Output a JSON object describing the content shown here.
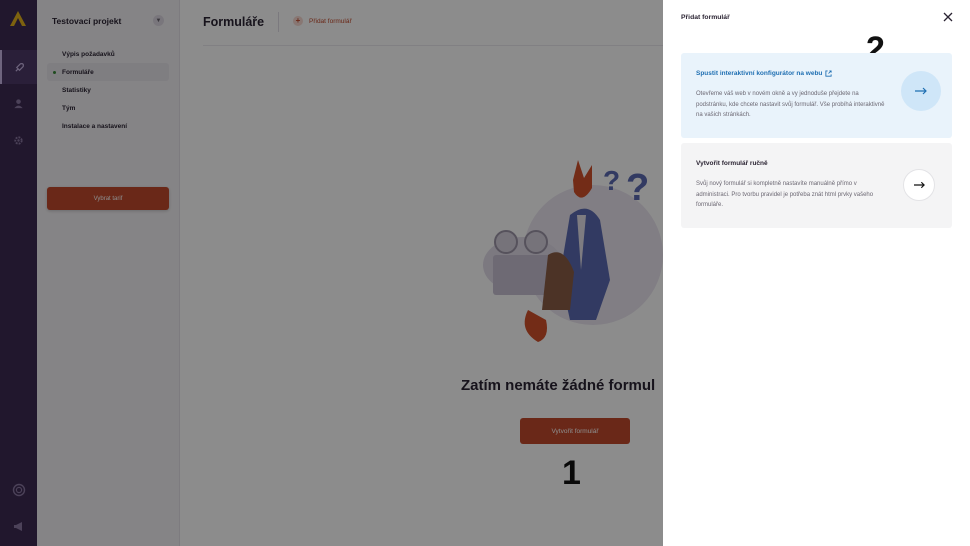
{
  "sidebar": {
    "project_name": "Testovací projekt",
    "items": [
      {
        "label": "Výpis požadavků"
      },
      {
        "label": "Formuláře"
      },
      {
        "label": "Statistiky"
      },
      {
        "label": "Tým"
      },
      {
        "label": "Instalace a nastavení"
      }
    ],
    "tariff_button": "Vybrat tarif"
  },
  "main": {
    "title": "Formuláře",
    "add_link": "Přidat formulář",
    "empty_text": "Zatím nemáte žádné formul",
    "create_button": "Vytvořit formulář"
  },
  "markers": {
    "one": "1",
    "two": "2"
  },
  "drawer": {
    "title": "Přidat formulář",
    "cards": [
      {
        "title": "Spustit interaktivní konfigurátor na webu",
        "description": "Otevřeme váš web v novém okně a vy jednoduše přejdete na podstránku, kde chcete nastavit svůj formulář. Vše probíhá interaktivně na vašich stránkách."
      },
      {
        "title": "Vytvořit formulář ručně",
        "description": "Svůj nový formulář si kompletně nastavíte manuálně přímo v administraci. Pro tvorbu pravidel je potřeba znát html prvky vašeho formuláře."
      }
    ]
  },
  "colors": {
    "brand": "#c24a2c",
    "rail": "#3d2a52",
    "link": "#1f6fb2",
    "highlight_card": "#e9f3fb"
  },
  "icons": {
    "rail": [
      "logo-icon",
      "rocket-icon",
      "user-icon",
      "gear-icon",
      "help-icon",
      "megaphone-icon"
    ],
    "drawer": [
      "close-icon",
      "external-link-icon",
      "arrow-right-icon"
    ]
  }
}
